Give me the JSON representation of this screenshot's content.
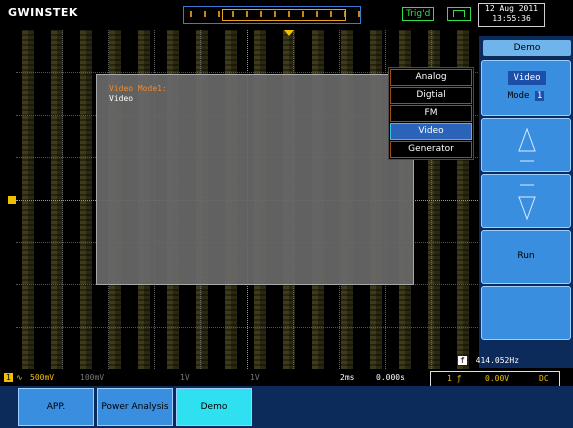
{
  "brand": "GWINSTEK",
  "trigger_status": "Trig'd",
  "datetime": {
    "date": "12 Aug 2011",
    "time": "13:55:36"
  },
  "demo_window": {
    "title": "Video Mode1:",
    "subtitle": "Video"
  },
  "popup_menu": {
    "items": [
      "Analog",
      "Digtial",
      "FM",
      "Video",
      "Generator"
    ],
    "selected": "Video"
  },
  "softkeys": {
    "title": "Demo",
    "mode_box": "Video",
    "mode_prefix": "Mode",
    "mode_number": "1",
    "run": "Run"
  },
  "status_row": {
    "ch1": "500mV",
    "ch2": "100mV",
    "ch3": "1V",
    "ch4": "1V",
    "timebase": "2ms",
    "position": "0.000s",
    "trig_level": "0.00V",
    "coupling": "DC"
  },
  "frequency": {
    "tag": "f",
    "value": "414.052Hz"
  },
  "function_keys": [
    {
      "label": "APP.",
      "active": false
    },
    {
      "label": "Power Analysis",
      "active": false
    },
    {
      "label": "Demo",
      "active": true
    }
  ],
  "colors": {
    "ch1": "#f0c000",
    "menu_blue": "#3a8ee0",
    "highlight": "#2ee0f0",
    "accent_orange": "#f28a2a"
  }
}
